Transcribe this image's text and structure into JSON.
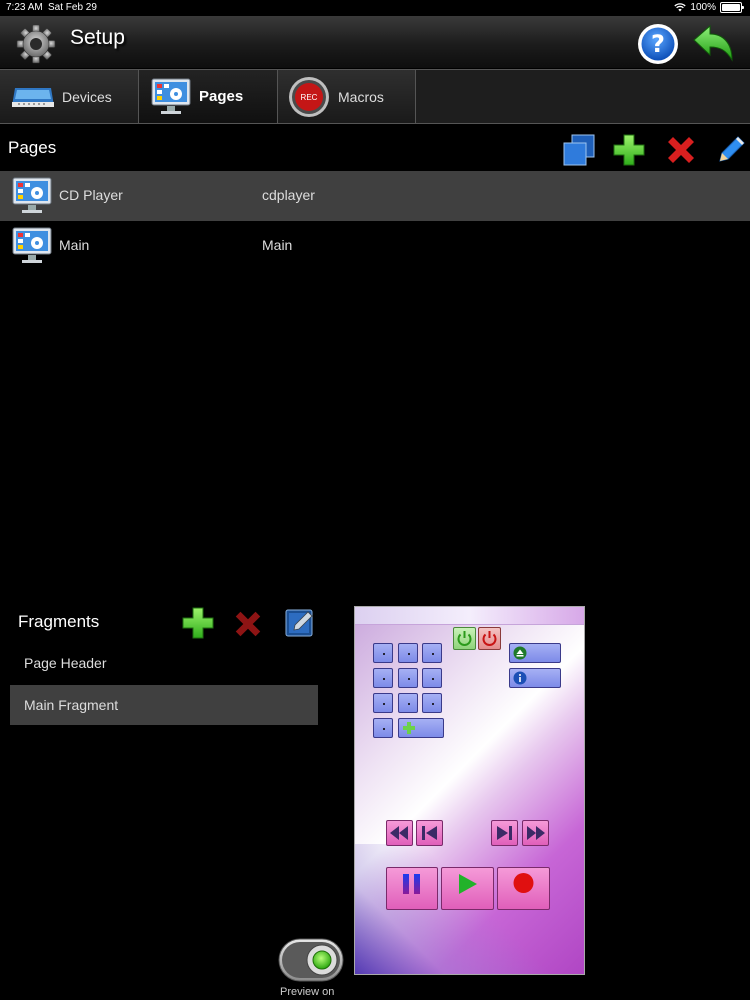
{
  "status": {
    "time": "7:23 AM",
    "date": "Sat Feb 29",
    "battery": "100%"
  },
  "header": {
    "title": "Setup"
  },
  "tabs": [
    {
      "label": "Devices"
    },
    {
      "label": "Pages"
    },
    {
      "label": "Macros",
      "badge": "REC"
    }
  ],
  "pages": {
    "title": "Pages",
    "rows": [
      {
        "name": "CD Player",
        "code": "cdplayer"
      },
      {
        "name": "Main",
        "code": "Main"
      }
    ]
  },
  "fragments": {
    "title": "Fragments",
    "items": [
      {
        "label": "Page Header"
      },
      {
        "label": "Main Fragment"
      }
    ]
  },
  "preview": {
    "toggle_label": "Preview on"
  },
  "colors": {
    "accent_green": "#2fae1b",
    "delete_red": "#d81f1f",
    "selected_row": "#404040"
  }
}
